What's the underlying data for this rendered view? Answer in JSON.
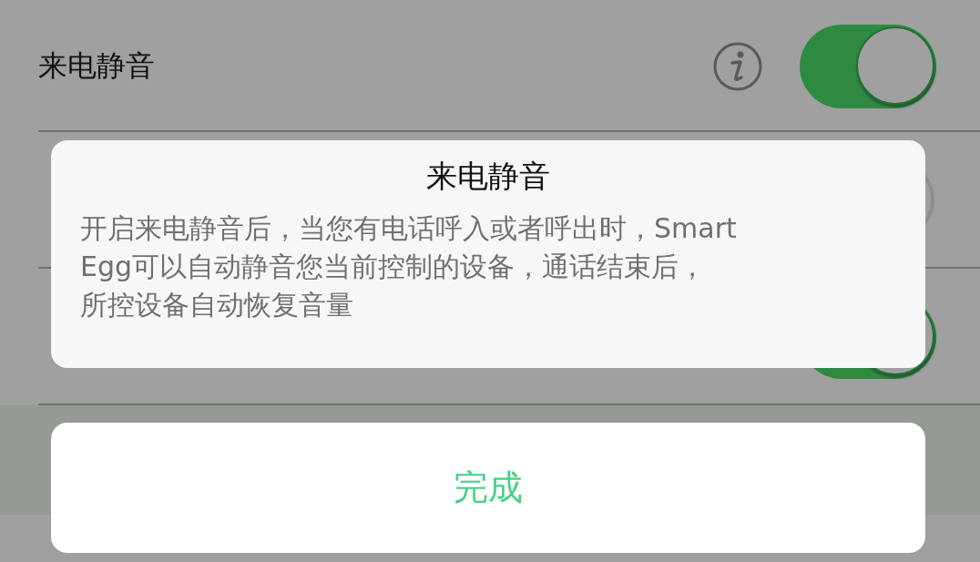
{
  "settings": [
    {
      "label": "来电静音",
      "info": true,
      "on": true
    },
    {
      "info": false,
      "on": false
    },
    {
      "info": false,
      "on": true
    }
  ],
  "dialog": {
    "title": "来电静音",
    "body_lines": [
      "开启来电静音后，当您有电话呼入或者呼出时，Smart",
      "Egg可以自动静音您当前控制的设备，通话结束后，",
      "所控设备自动恢复音量"
    ]
  },
  "done_button": "完成"
}
